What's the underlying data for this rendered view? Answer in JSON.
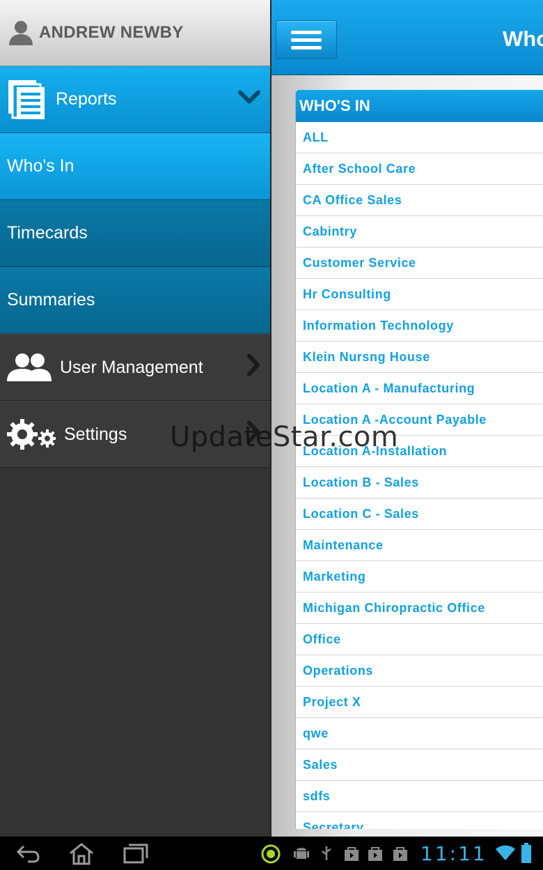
{
  "drawer": {
    "user_name": "ANDREW NEWBY",
    "reports_label": "Reports",
    "sub_items": [
      {
        "label": "Who's In"
      },
      {
        "label": "Timecards"
      },
      {
        "label": "Summaries"
      }
    ],
    "user_management_label": "User Management",
    "settings_label": "Settings"
  },
  "topbar": {
    "title": "Who"
  },
  "card": {
    "header": "WHO'S IN",
    "items": [
      "ALL",
      "After School Care",
      "CA Office Sales",
      "Cabintry",
      "Customer Service",
      "Hr Consulting",
      "Information Technology",
      "Klein Nursng House",
      "Location A - Manufacturing",
      "Location A -Account Payable",
      "Location A-Installation",
      "Location B - Sales",
      "Location C - Sales",
      "Maintenance",
      "Marketing",
      "Michigan Chiropractic Office",
      "Office",
      "Operations",
      "Project X",
      "qwe",
      "Sales",
      "sdfs",
      "Secretary"
    ]
  },
  "watermark": "UpdateStar.com",
  "status_bar": {
    "clock": "11:11"
  },
  "colors": {
    "accent": "#13a0e0",
    "header_blue": "#0a8ad0",
    "drawer_dark": "#333333"
  }
}
